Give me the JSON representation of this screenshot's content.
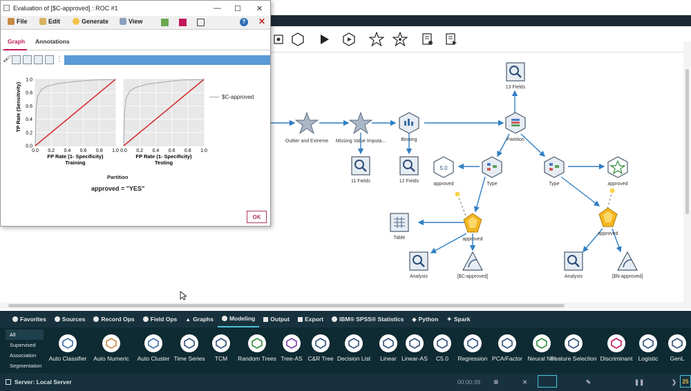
{
  "dialog": {
    "title": "Evaluation of [$C-approved] : ROC #1",
    "menu": [
      "File",
      "Edit",
      "Generate",
      "View"
    ],
    "tabs": [
      "Graph",
      "Annotations"
    ],
    "chart_left_caption": "Training",
    "chart_right_caption": "Testing",
    "x_axis_label": "FP Rate (1- Specificity)",
    "y_axis_label": "TP Rate (Sensitivity)",
    "partition_label": "Partition",
    "condition_label": "approved = \"YES\"",
    "legend_label": "$C-approved",
    "ok_label": "OK"
  },
  "chart_data": [
    {
      "type": "line",
      "caption": "Training",
      "xlabel": "FP Rate (1- Specificity)",
      "ylabel": "TP Rate (Sensitivity)",
      "xlim": [
        0,
        1
      ],
      "ylim": [
        0,
        1
      ],
      "ticks": [
        "0.0",
        "0.2",
        "0.4",
        "0.6",
        "0.8",
        "1.0"
      ],
      "series": [
        {
          "name": "$C-approved",
          "color": "#9aa7b0",
          "x": [
            0,
            0.01,
            0.03,
            0.08,
            0.15,
            0.3,
            0.5,
            0.7,
            1.0
          ],
          "y": [
            0,
            0.55,
            0.75,
            0.85,
            0.9,
            0.94,
            0.97,
            0.99,
            1.0
          ]
        },
        {
          "color": "#d32f2f",
          "x": [
            0,
            1
          ],
          "y": [
            0,
            1
          ]
        }
      ]
    },
    {
      "type": "line",
      "caption": "Testing",
      "xlabel": "FP Rate (1- Specificity)",
      "xlim": [
        0,
        1
      ],
      "ylim": [
        0,
        1
      ],
      "ticks": [
        "0.0",
        "0.2",
        "0.4",
        "0.6",
        "0.8",
        "1.0"
      ],
      "series": [
        {
          "name": "$C-approved",
          "color": "#9aa7b0",
          "x": [
            0,
            0.01,
            0.03,
            0.08,
            0.15,
            0.3,
            0.5,
            0.7,
            1.0
          ],
          "y": [
            0,
            0.5,
            0.72,
            0.83,
            0.88,
            0.93,
            0.96,
            0.99,
            1.0
          ]
        },
        {
          "color": "#d32f2f",
          "x": [
            0,
            1
          ],
          "y": [
            0,
            1
          ]
        }
      ]
    }
  ],
  "y_ticks": [
    "0.0",
    "0.2",
    "0.4",
    "0.6",
    "0.8",
    "1.0"
  ],
  "stream_nodes": [
    {
      "id": "outlier",
      "label": "Outlier and Extreme"
    },
    {
      "id": "missing",
      "label": "Missing Value Imputa..."
    },
    {
      "id": "binning",
      "label": "Binning"
    },
    {
      "id": "partition",
      "label": "Partition"
    },
    {
      "id": "fields13",
      "label": "13 Fields"
    },
    {
      "id": "fields11",
      "label": "11 Fields"
    },
    {
      "id": "fields12",
      "label": "12 Fields"
    },
    {
      "id": "approved_c50",
      "label": "approved"
    },
    {
      "id": "type1",
      "label": "Type"
    },
    {
      "id": "type2",
      "label": "Type"
    },
    {
      "id": "approved_nn",
      "label": "approved"
    },
    {
      "id": "table",
      "label": "Table"
    },
    {
      "id": "approved_gem1",
      "label": "approved"
    },
    {
      "id": "approved_gem2",
      "label": "approved"
    },
    {
      "id": "analysis1",
      "label": "Analysis"
    },
    {
      "id": "c_approved",
      "label": "[$C-approved]"
    },
    {
      "id": "analysis2",
      "label": "Analysis"
    },
    {
      "id": "n_approved",
      "label": "[$N-approved]"
    }
  ],
  "palette": {
    "tabs": [
      "Favorites",
      "Sources",
      "Record Ops",
      "Field Ops",
      "Graphs",
      "Modeling",
      "Output",
      "Export",
      "IBM® SPSS® Statistics",
      "Python",
      "Spark"
    ],
    "active_tab": "Modeling",
    "categories": [
      "All",
      "Supervised",
      "Association",
      "Segmentation"
    ],
    "nodes": [
      "Auto Classifier",
      "Auto Numeric",
      "Auto Cluster",
      "Time Series",
      "TCM",
      "Random Trees",
      "Tree-AS",
      "C&R Tree",
      "Decision List",
      "Linear",
      "Linear-AS",
      "C5.0",
      "Regression",
      "PCA/Factor",
      "Neural Net",
      "Feature Selection",
      "Discriminant",
      "Logistic",
      "GenL"
    ]
  },
  "status": {
    "server": "Server: Local Server",
    "timer": "00:00:39",
    "badge": "25"
  },
  "colors": {
    "palette_bg": "#0e2a33",
    "tab_bg": "#17323e",
    "accent": "#c2185b",
    "link_blue": "#2f7fc4"
  }
}
